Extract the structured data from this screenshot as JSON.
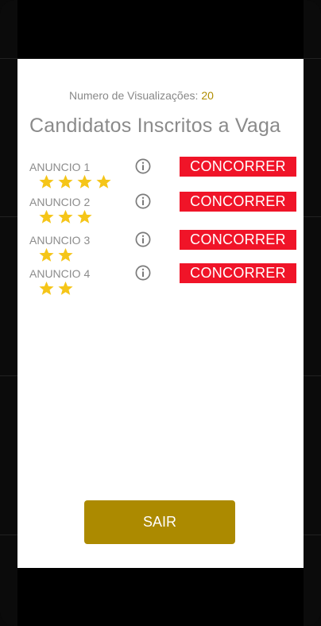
{
  "header": {
    "views_label": "Numero de Visualizações:",
    "views_count": "20",
    "title": "Candidatos Inscritos a Vaga"
  },
  "ads": [
    {
      "label": "ANUNCIO 1",
      "rating": 4,
      "button_label": "CONCORRER"
    },
    {
      "label": "ANUNCIO 2",
      "rating": 3,
      "button_label": "CONCORRER"
    },
    {
      "label": "ANUNCIO 3",
      "rating": 2,
      "button_label": "CONCORRER"
    },
    {
      "label": "ANUNCIO 4",
      "rating": 2,
      "button_label": "CONCORRER"
    }
  ],
  "icons": {
    "star": "star-icon",
    "info": "info-icon"
  },
  "colors": {
    "accent_red": "#f01428",
    "star_yellow": "#f5c518",
    "views_count": "#b08d00",
    "exit_button": "#ac8a00"
  },
  "footer": {
    "exit_label": "SAIR"
  }
}
